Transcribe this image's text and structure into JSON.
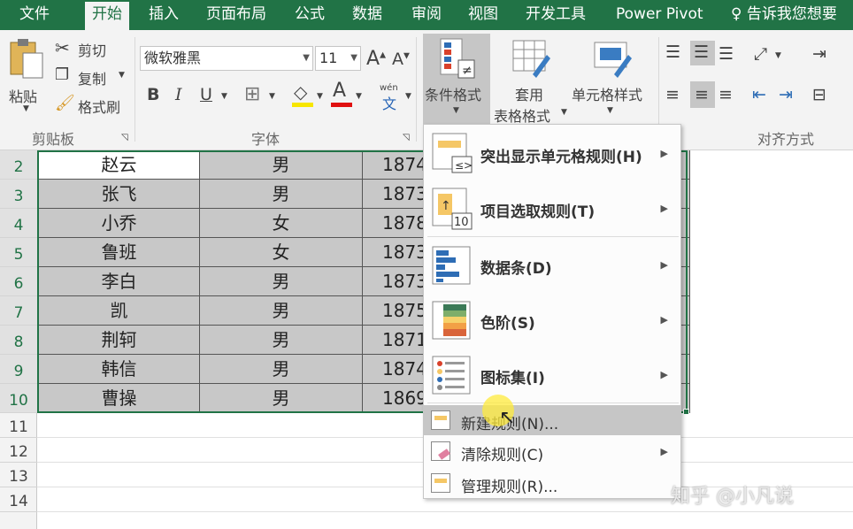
{
  "ribbon_tabs": [
    "文件",
    "开始",
    "插入",
    "页面布局",
    "公式",
    "数据",
    "审阅",
    "视图",
    "开发工具",
    "Power Pivot"
  ],
  "tell_me": "告诉我您想要",
  "clipboard": {
    "paste": "粘贴",
    "cut": "剪切",
    "copy": "复制",
    "format_painter": "格式刷",
    "group": "剪贴板"
  },
  "font": {
    "name": "微软雅黑",
    "size": "11",
    "group": "字体",
    "bold": "B",
    "italic": "I",
    "underline": "U",
    "font_color": "A",
    "phonetic_top": "wén",
    "phonetic_bottom": "文"
  },
  "styles": {
    "conditional_format": "条件格式",
    "table_format_1": "套用",
    "table_format_2": "表格格式",
    "cell_style": "单元格样式"
  },
  "alignment": {
    "group": "对齐方式"
  },
  "rows": [
    {
      "num": "2",
      "name": "赵云",
      "gender": "男",
      "value": "1874"
    },
    {
      "num": "3",
      "name": "张飞",
      "gender": "男",
      "value": "1873"
    },
    {
      "num": "4",
      "name": "小乔",
      "gender": "女",
      "value": "1878"
    },
    {
      "num": "5",
      "name": "鲁班",
      "gender": "女",
      "value": "1873"
    },
    {
      "num": "6",
      "name": "李白",
      "gender": "男",
      "value": "1873"
    },
    {
      "num": "7",
      "name": "凯",
      "gender": "男",
      "value": "1875"
    },
    {
      "num": "8",
      "name": "荆轲",
      "gender": "男",
      "value": "1871"
    },
    {
      "num": "9",
      "name": "韩信",
      "gender": "男",
      "value": "1874"
    },
    {
      "num": "10",
      "name": "曹操",
      "gender": "男",
      "value": "1869"
    }
  ],
  "empty_rows": [
    "11",
    "12",
    "13",
    "14"
  ],
  "menu": {
    "highlight": "突出显示单元格规则(H)",
    "top_bottom": "项目选取规则(T)",
    "data_bars": "数据条(D)",
    "color_scales": "色阶(S)",
    "icon_sets": "图标集(I)",
    "new_rule": "新建规则(N)...",
    "clear_rules": "清除规则(C)",
    "manage_rules": "管理规则(R)...",
    "top10_icon_text": "10"
  },
  "watermark": "知乎 @小凡说",
  "colors": {
    "excel_green": "#217346",
    "selected_fill": "#c8c8c8"
  }
}
